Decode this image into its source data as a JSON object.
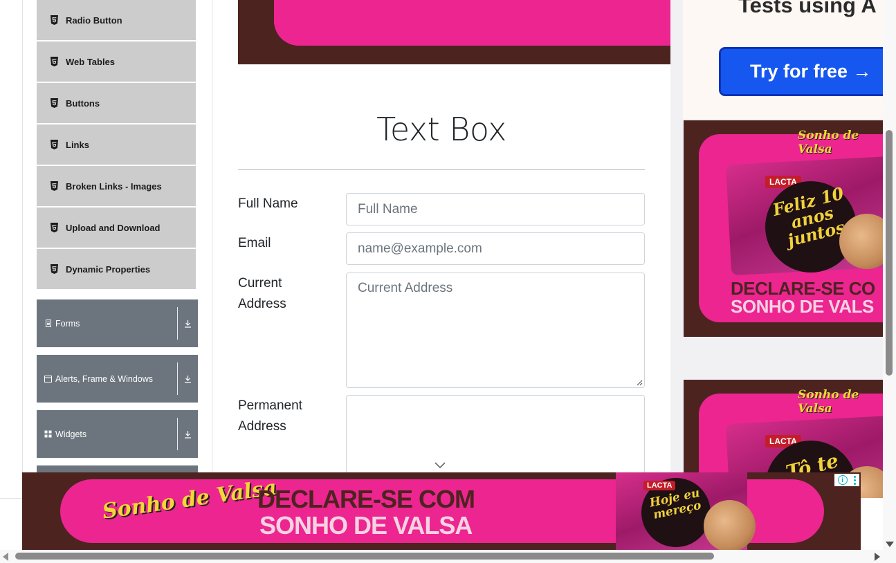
{
  "sidebar": {
    "items": [
      {
        "label": "Radio Button"
      },
      {
        "label": "Web Tables"
      },
      {
        "label": "Buttons"
      },
      {
        "label": "Links"
      },
      {
        "label": "Broken Links - Images"
      },
      {
        "label": "Upload and Download"
      },
      {
        "label": "Dynamic Properties"
      }
    ],
    "groups": [
      {
        "label": "Forms"
      },
      {
        "label": "Alerts, Frame & Windows"
      },
      {
        "label": "Widgets"
      }
    ]
  },
  "main": {
    "title": "Text Box",
    "form": {
      "full_name_label": "Full Name",
      "full_name_placeholder": "Full Name",
      "email_label": "Email",
      "email_placeholder": "name@example.com",
      "current_address_label": "Current Address",
      "current_address_placeholder": "Current Address",
      "permanent_address_label": "Permanent Address"
    }
  },
  "ads": {
    "top_right_headline": "Tests using A",
    "try_button": "Try for free →",
    "lacta": "LACTA",
    "logo": "Sonho de Valsa",
    "choc1_text": "Feliz 10 anos juntos",
    "choc2_text": "Tô te",
    "decl_line1": "DECLARE-SE CO",
    "decl_line2": "SONHO DE VALS",
    "bottom_line1": "DECLARE-SE COM",
    "bottom_line2": "SONHO DE VALSA",
    "bottom_choc_text": "Hoje eu mereço",
    "info_glyph": "i"
  },
  "colors": {
    "sidebar_item_bg": "#cccccc",
    "group_bg": "#6c757d",
    "ad_brown": "#4d2320",
    "ad_pink": "#ec2590",
    "try_blue": "#1657f0"
  }
}
